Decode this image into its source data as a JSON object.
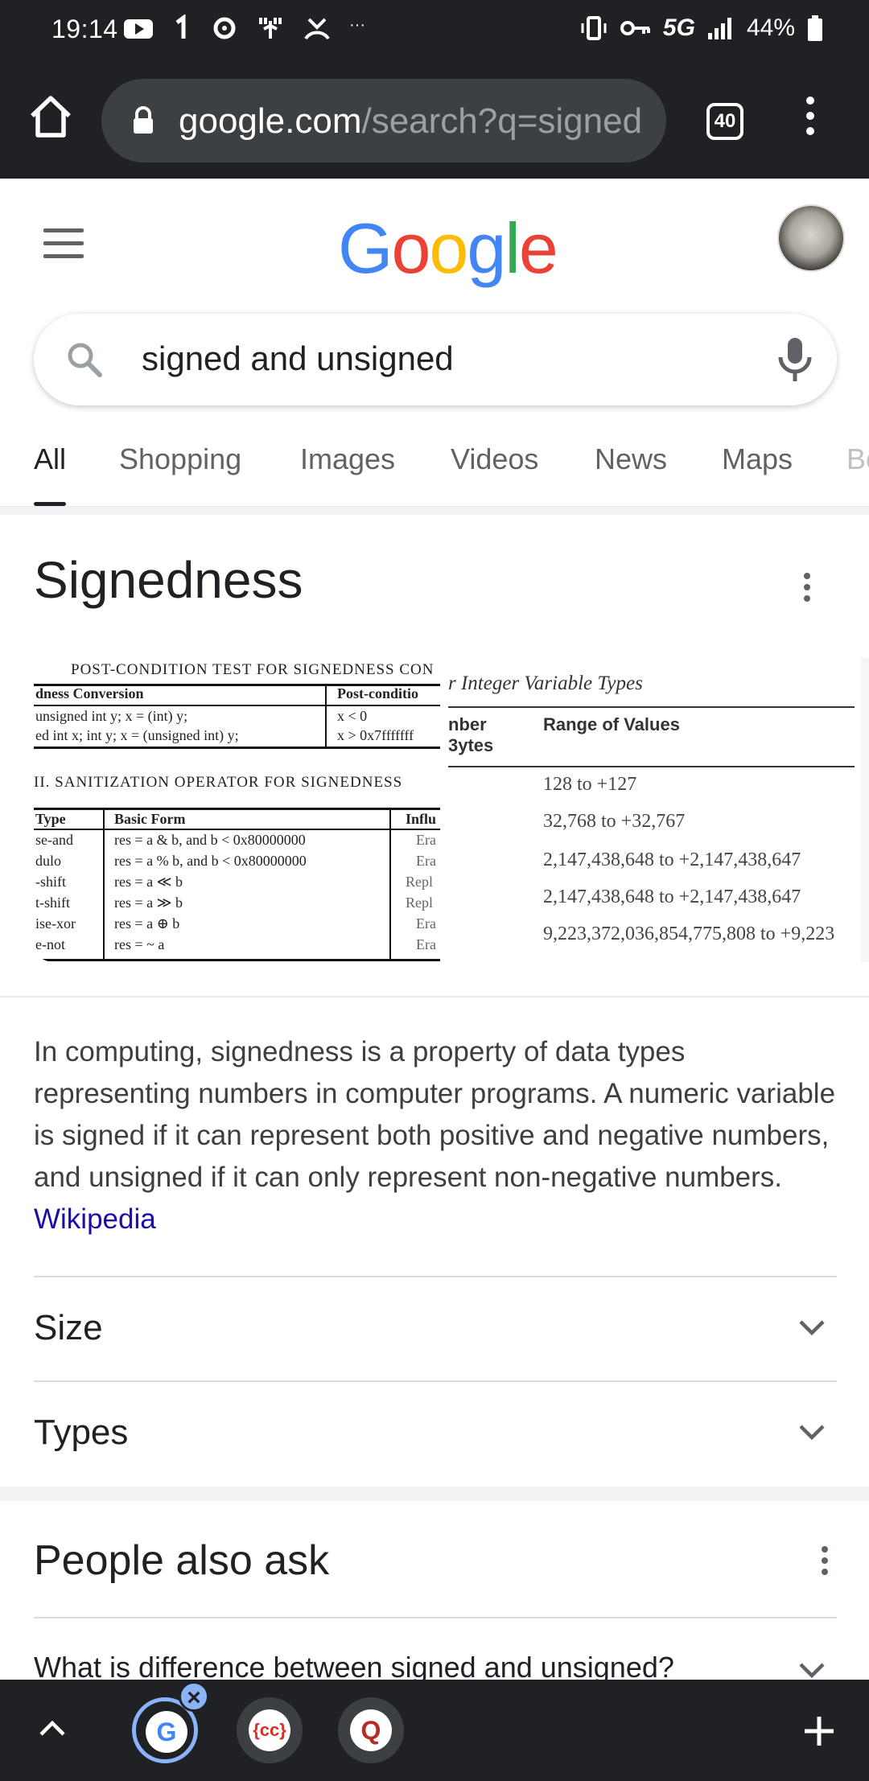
{
  "status_bar": {
    "time": "19:14",
    "network": "5G",
    "battery": "44%",
    "overflow": "···"
  },
  "browser": {
    "url_domain": "google.com",
    "url_path": "/search?q=signed",
    "tab_count": "40"
  },
  "google": {
    "logo_letters": [
      "G",
      "o",
      "o",
      "g",
      "l",
      "e"
    ],
    "search_query": "signed and unsigned",
    "tabs": [
      "All",
      "Shopping",
      "Images",
      "Videos",
      "News",
      "Maps",
      "Bo"
    ],
    "active_tab": "All"
  },
  "knowledge_panel": {
    "title": "Signedness",
    "image1": {
      "caption_top": "POST-CONDITION TEST FOR SIGNEDNESS CON",
      "table1_header": [
        "dness Conversion",
        "Post-conditio"
      ],
      "table1_rows": [
        [
          "unsigned int y; x = (int) y;",
          "x < 0"
        ],
        [
          "ed int x; int y; x = (unsigned int) y;",
          "x > 0x7fffffff"
        ]
      ],
      "caption_mid": "II.    SANITIZATION OPERATOR FOR SIGNEDNESS",
      "table2_header": [
        "Type",
        "Basic Form",
        "Influ"
      ],
      "table2_rows": [
        [
          "se-and",
          "res = a & b, and b < 0x80000000",
          "Era"
        ],
        [
          "dulo",
          "res = a % b, and b < 0x80000000",
          "Era"
        ],
        [
          "-shift",
          "res = a ≪ b",
          "Repl"
        ],
        [
          "t-shift",
          "res = a ≫ b",
          "Repl"
        ],
        [
          "ise-xor",
          "res = a ⊕ b",
          "Era"
        ],
        [
          "e-not",
          "res = ~ a",
          "Era"
        ]
      ]
    },
    "image2": {
      "caption": "r Integer Variable Types",
      "header_col1": "nber",
      "header_col1b": "3ytes",
      "header_col2": "Range of Values",
      "values": [
        "128 to +127",
        "32,768 to +32,767",
        "2,147,438,648 to +2,147,438,647",
        "2,147,438,648 to +2,147,438,647",
        "9,223,372,036,854,775,808 to +9,223"
      ]
    },
    "description": "In computing, signedness is a property of data types representing numbers in computer programs. A numeric variable is signed if it can represent both positive and negative numbers, and unsigned if it can only represent non-negative numbers.",
    "source_link": "Wikipedia",
    "accordions": [
      "Size",
      "Types"
    ]
  },
  "people_also_ask": {
    "title": "People also ask",
    "questions": [
      "What is difference between signed and unsigned?"
    ]
  },
  "bottom_bar": {
    "tab_icons": [
      "G",
      "{cc}",
      "Q"
    ]
  }
}
